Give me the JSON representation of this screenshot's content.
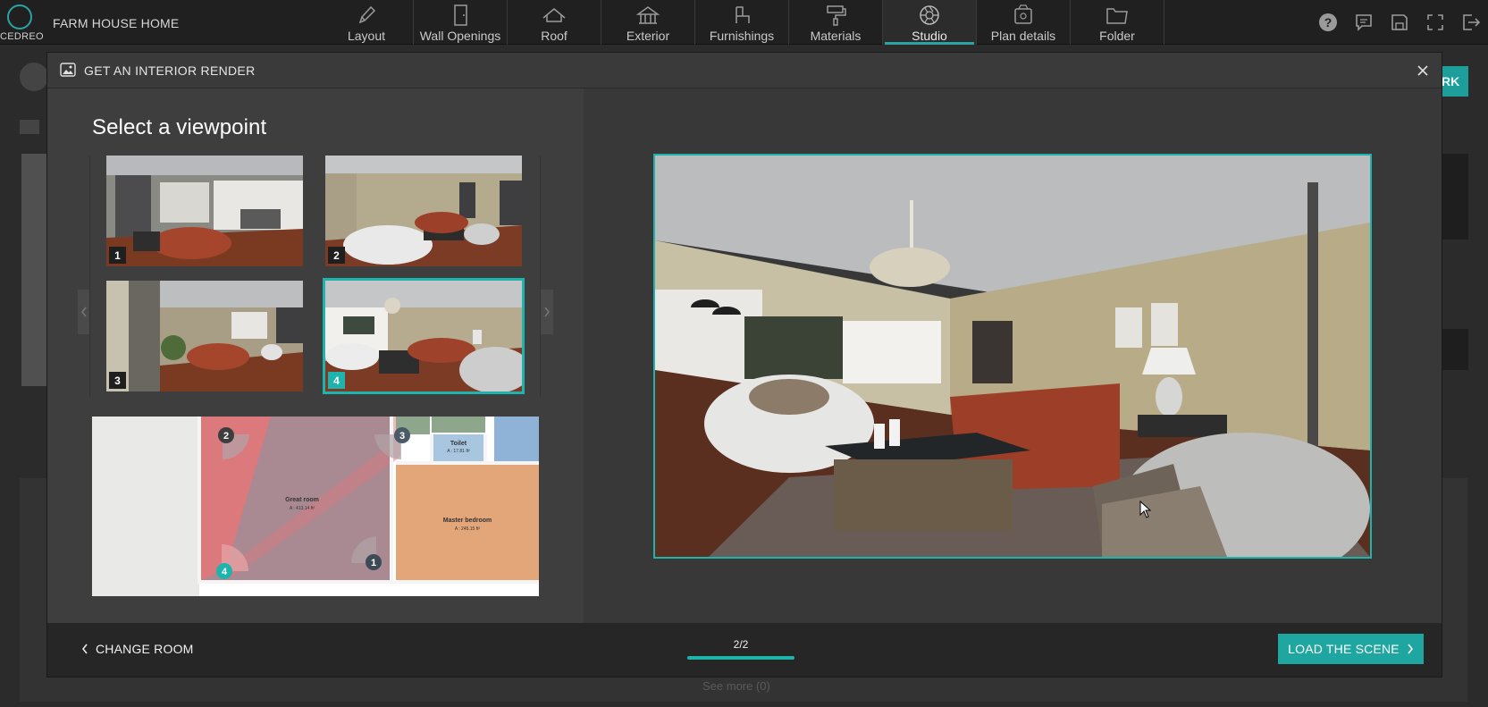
{
  "app": {
    "logo_text": "CEDREO",
    "project_name": "FARM HOUSE HOME",
    "accent_color": "#1fb3ad"
  },
  "nav": {
    "items": [
      {
        "label": "Layout",
        "icon": "pencil-icon"
      },
      {
        "label": "Wall Openings",
        "icon": "door-icon"
      },
      {
        "label": "Roof",
        "icon": "roof-icon"
      },
      {
        "label": "Exterior",
        "icon": "gazebo-icon"
      },
      {
        "label": "Furnishings",
        "icon": "chair-icon"
      },
      {
        "label": "Materials",
        "icon": "paint-roller-icon"
      },
      {
        "label": "Studio",
        "icon": "camera-aperture-icon",
        "active": true
      },
      {
        "label": "Plan details",
        "icon": "plan-details-icon"
      },
      {
        "label": "Folder",
        "icon": "folder-icon"
      }
    ],
    "right_icons": [
      "help-icon",
      "comment-icon",
      "save-icon",
      "fullscreen-icon",
      "logout-icon"
    ]
  },
  "background": {
    "teal_button_fragment": "RK",
    "see_more": "See more (0)"
  },
  "modal": {
    "title": "GET AN INTERIOR RENDER",
    "heading": "Select a viewpoint",
    "viewpoints": [
      {
        "number": "1",
        "selected": false
      },
      {
        "number": "2",
        "selected": false
      },
      {
        "number": "3",
        "selected": false
      },
      {
        "number": "4",
        "selected": true
      }
    ],
    "plan": {
      "rooms": [
        {
          "name": "Great room",
          "area": "A : 413.14 ft²"
        },
        {
          "name": "Master bedroom",
          "area": "A : 245.15 ft²"
        },
        {
          "name": "Toilet",
          "area": "A : 17.81 ft²"
        }
      ],
      "markers": [
        "1",
        "2",
        "3",
        "4"
      ]
    },
    "footer": {
      "change_room": "CHANGE ROOM",
      "pager": "2/2",
      "load_scene": "LOAD THE SCENE"
    }
  }
}
